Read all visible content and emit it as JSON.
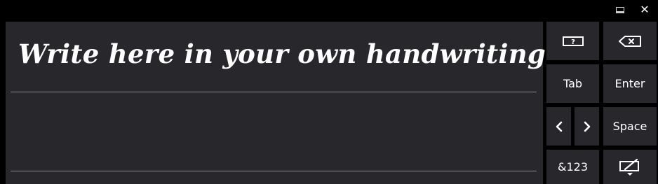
{
  "window": {
    "minimize_icon": "minimize-icon",
    "close_glyph": "✕"
  },
  "handwriting_pad": {
    "hint": "Write here in your own handwriting"
  },
  "keys": {
    "help_icon": "help-icon",
    "backspace_icon": "backspace-icon",
    "tab": "Tab",
    "enter": "Enter",
    "left_arrow": "‹",
    "right_arrow": "›",
    "space": "Space",
    "symbols": "&123",
    "keyboard_icon": "keyboard-switch-icon"
  },
  "colors": {
    "background": "#000000",
    "pad": "#28272c",
    "key": "#28272c",
    "guide_line": "#8a8a8f",
    "text": "#ffffff"
  }
}
